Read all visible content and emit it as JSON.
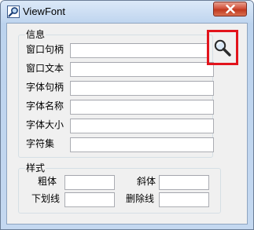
{
  "window": {
    "title": "ViewFont"
  },
  "info_group": {
    "title": "信息",
    "rows": [
      {
        "label": "窗口句柄",
        "value": ""
      },
      {
        "label": "窗口文本",
        "value": ""
      },
      {
        "label": "字体句柄",
        "value": ""
      },
      {
        "label": "字体名称",
        "value": ""
      },
      {
        "label": "字体大小",
        "value": ""
      },
      {
        "label": "字符集",
        "value": ""
      }
    ]
  },
  "style_group": {
    "title": "样式",
    "bold_label": "粗体",
    "bold_value": "",
    "italic_label": "斜体",
    "italic_value": "",
    "underline_label": "下划线",
    "underline_value": "",
    "strikeout_label": "删除线",
    "strikeout_value": ""
  },
  "icons": {
    "app": "magnifier-icon",
    "search": "magnifier-icon",
    "close": "close-icon"
  },
  "colors": {
    "highlight_border": "#e2141c",
    "close_button": "#c0391f"
  }
}
